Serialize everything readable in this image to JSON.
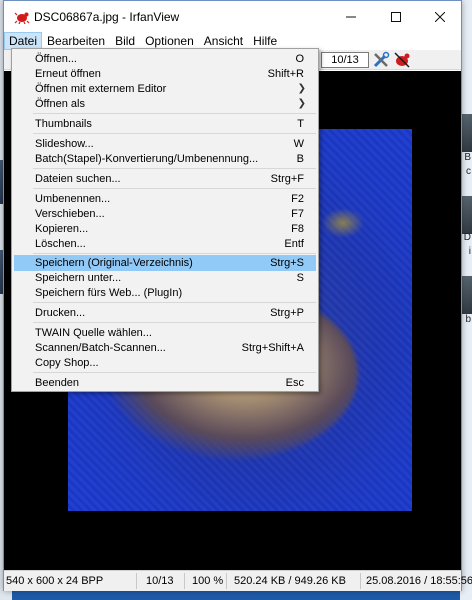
{
  "window": {
    "title": "DSC06867a.jpg - IrfanView"
  },
  "menubar": [
    "Datei",
    "Bearbeiten",
    "Bild",
    "Optionen",
    "Ansicht",
    "Hilfe"
  ],
  "toolbar": {
    "page_counter": "10/13"
  },
  "dropdown": [
    {
      "label": "Öffnen...",
      "shortcut": "O",
      "submenu": false
    },
    {
      "label": "Erneut öffnen",
      "shortcut": "Shift+R",
      "submenu": false
    },
    {
      "label": "Öffnen mit externem Editor",
      "shortcut": "",
      "submenu": true
    },
    {
      "label": "Öffnen als",
      "shortcut": "",
      "submenu": true
    },
    {
      "label": "Thumbnails",
      "shortcut": "T",
      "submenu": false
    },
    {
      "label": "Slideshow...",
      "shortcut": "W",
      "submenu": false
    },
    {
      "label": "Batch(Stapel)-Konvertierung/Umbenennung...",
      "shortcut": "B",
      "submenu": false
    },
    {
      "label": "Dateien suchen...",
      "shortcut": "Strg+F",
      "submenu": false
    },
    {
      "label": "Umbenennen...",
      "shortcut": "F2",
      "submenu": false
    },
    {
      "label": "Verschieben...",
      "shortcut": "F7",
      "submenu": false
    },
    {
      "label": "Kopieren...",
      "shortcut": "F8",
      "submenu": false
    },
    {
      "label": "Löschen...",
      "shortcut": "Entf",
      "submenu": false
    },
    {
      "label": "Speichern (Original-Verzeichnis)",
      "shortcut": "Strg+S",
      "submenu": false
    },
    {
      "label": "Speichern unter...",
      "shortcut": "S",
      "submenu": false
    },
    {
      "label": "Speichern fürs Web... (PlugIn)",
      "shortcut": "",
      "submenu": false
    },
    {
      "label": "Drucken...",
      "shortcut": "Strg+P",
      "submenu": false
    },
    {
      "label": "TWAIN Quelle wählen...",
      "shortcut": "",
      "submenu": false
    },
    {
      "label": "Scannen/Batch-Scannen...",
      "shortcut": "Strg+Shift+A",
      "submenu": false
    },
    {
      "label": "Copy Shop...",
      "shortcut": "",
      "submenu": false
    },
    {
      "label": "Beenden",
      "shortcut": "Esc",
      "submenu": false
    }
  ],
  "statusbar": {
    "dimensions": "540 x 600 x 24 BPP",
    "position": "10/13",
    "zoom": "100 %",
    "filesize": "520.24 KB / 949.26 KB",
    "datetime": "25.08.2016 / 18:55:56"
  },
  "background": {
    "right_labels": [
      "B",
      "c",
      "D",
      "i",
      "b"
    ]
  },
  "colors": {
    "menu_highlight": "#91c9f7",
    "menubar_active": "#cce4f7",
    "photo_blue": "#1b39c9"
  }
}
